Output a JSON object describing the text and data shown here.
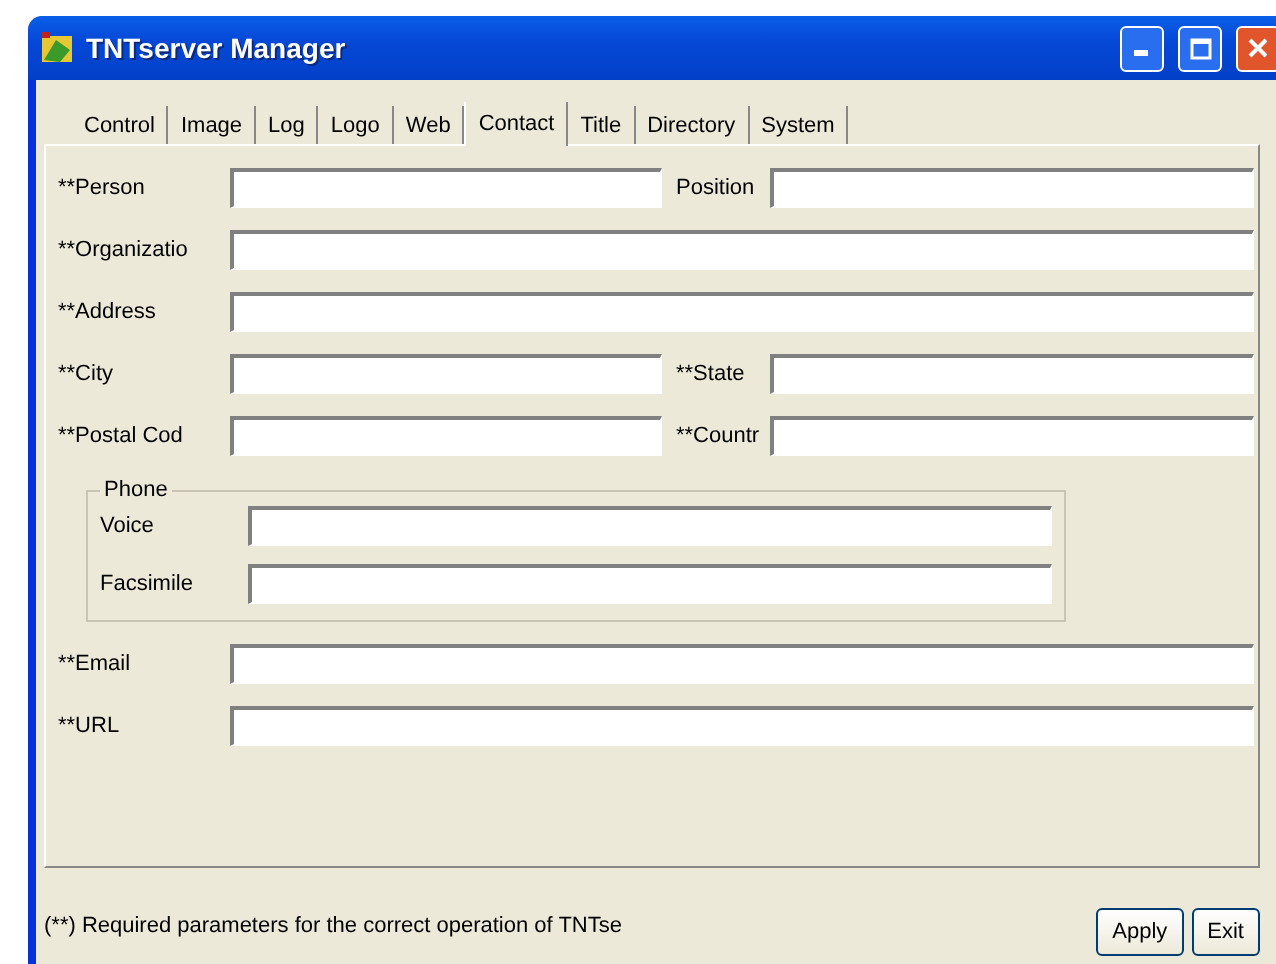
{
  "window": {
    "title": "TNTserver Manager"
  },
  "tabs": [
    {
      "label": "Control",
      "selected": false
    },
    {
      "label": "Image",
      "selected": false
    },
    {
      "label": "Log",
      "selected": false
    },
    {
      "label": "Logo",
      "selected": false
    },
    {
      "label": "Web",
      "selected": false
    },
    {
      "label": "Contact",
      "selected": true
    },
    {
      "label": "Title",
      "selected": false
    },
    {
      "label": "Directory",
      "selected": false
    },
    {
      "label": "System",
      "selected": false
    }
  ],
  "rows": [
    {
      "fields": [
        {
          "label": "**Person"
        },
        {
          "label": "Position"
        }
      ]
    },
    {
      "fields": [
        {
          "label": "**Organizatio"
        }
      ]
    },
    {
      "fields": [
        {
          "label": "**Address"
        }
      ]
    },
    {
      "fields": [
        {
          "label": "**City"
        },
        {
          "label": "**State"
        }
      ]
    },
    {
      "fields": [
        {
          "label": "**Postal Cod"
        },
        {
          "label": "**Countr"
        }
      ]
    }
  ],
  "phone": {
    "title": "Phone",
    "fields": [
      {
        "label": "Voice"
      },
      {
        "label": "Facsimile"
      }
    ]
  },
  "rows_after": [
    {
      "fields": [
        {
          "label": "**Email"
        }
      ]
    },
    {
      "fields": [
        {
          "label": "**URL"
        }
      ]
    }
  ],
  "footnote": "(**) Required parameters for the correct operation of TNTse",
  "buttons": [
    "Apply",
    "Exit"
  ]
}
